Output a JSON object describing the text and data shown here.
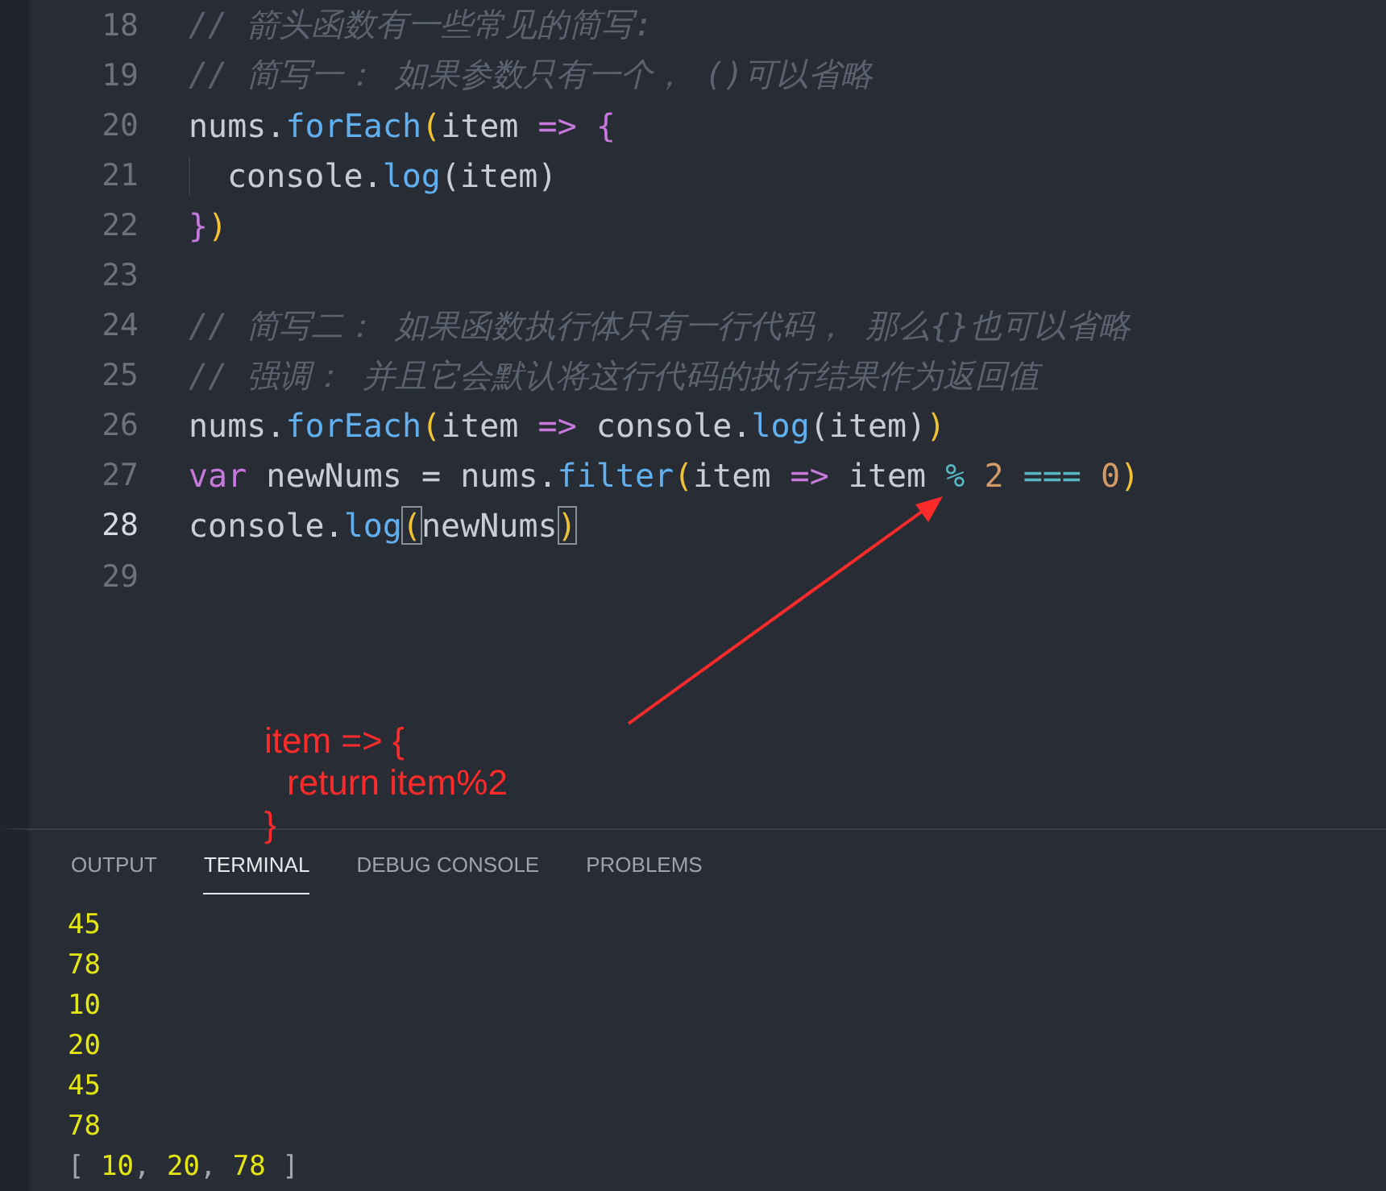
{
  "editor": {
    "lines": [
      {
        "number": "18",
        "active": false,
        "guide": false,
        "tokens": [
          {
            "kind": "comment",
            "text": "// 箭头函数有一些常见的简写:"
          }
        ]
      },
      {
        "number": "19",
        "active": false,
        "guide": false,
        "tokens": [
          {
            "kind": "comment",
            "text": "// 简写一： 如果参数只有一个， ()可以省略"
          }
        ]
      },
      {
        "number": "20",
        "active": false,
        "guide": false,
        "tokens": [
          {
            "kind": "plain",
            "text": "nums."
          },
          {
            "kind": "fn",
            "text": "forEach"
          },
          {
            "kind": "paren",
            "text": "("
          },
          {
            "kind": "plain",
            "text": "item "
          },
          {
            "kind": "keyword",
            "text": "=>"
          },
          {
            "kind": "brace",
            "text": " {"
          }
        ]
      },
      {
        "number": "21",
        "active": false,
        "guide": true,
        "tokens": [
          {
            "kind": "plain",
            "text": "console."
          },
          {
            "kind": "fn",
            "text": "log"
          },
          {
            "kind": "plain",
            "text": "(item)"
          }
        ]
      },
      {
        "number": "22",
        "active": false,
        "guide": false,
        "tokens": [
          {
            "kind": "brace",
            "text": "}"
          },
          {
            "kind": "paren",
            "text": ")"
          }
        ]
      },
      {
        "number": "23",
        "active": false,
        "guide": false
      },
      {
        "number": "24",
        "active": false,
        "guide": false,
        "tokens": [
          {
            "kind": "comment",
            "text": "// 简写二： 如果函数执行体只有一行代码， 那么{}也可以省略"
          }
        ]
      },
      {
        "number": "25",
        "active": false,
        "guide": false,
        "tokens": [
          {
            "kind": "comment",
            "text": "// 强调： 并且它会默认将这行代码的执行结果作为返回值"
          }
        ]
      },
      {
        "number": "26",
        "active": false,
        "guide": false,
        "tokens": [
          {
            "kind": "plain",
            "text": "nums."
          },
          {
            "kind": "fn",
            "text": "forEach"
          },
          {
            "kind": "paren",
            "text": "("
          },
          {
            "kind": "plain",
            "text": "item "
          },
          {
            "kind": "keyword",
            "text": "=>"
          },
          {
            "kind": "plain",
            "text": " console."
          },
          {
            "kind": "fn",
            "text": "log"
          },
          {
            "kind": "plain",
            "text": "(item)"
          },
          {
            "kind": "paren",
            "text": ")"
          }
        ]
      },
      {
        "number": "27",
        "active": false,
        "guide": false,
        "tokens": [
          {
            "kind": "keyword",
            "text": "var"
          },
          {
            "kind": "plain",
            "text": " newNums = nums."
          },
          {
            "kind": "fn",
            "text": "filter"
          },
          {
            "kind": "paren",
            "text": "("
          },
          {
            "kind": "plain",
            "text": "item "
          },
          {
            "kind": "keyword",
            "text": "=>"
          },
          {
            "kind": "plain",
            "text": " item "
          },
          {
            "kind": "operator",
            "text": "%"
          },
          {
            "kind": "number",
            "text": " 2"
          },
          {
            "kind": "operator",
            "text": " ==="
          },
          {
            "kind": "number",
            "text": " 0"
          },
          {
            "kind": "paren",
            "text": ")"
          }
        ]
      },
      {
        "number": "28",
        "active": true,
        "guide": false,
        "tokens": [
          {
            "kind": "plain",
            "text": "console."
          },
          {
            "kind": "fn",
            "text": "log"
          },
          {
            "kind": "matched",
            "text": "("
          },
          {
            "kind": "plain",
            "text": "newNums"
          },
          {
            "kind": "matched",
            "text": ")"
          }
        ]
      },
      {
        "number": "29",
        "active": false,
        "guide": false
      }
    ]
  },
  "panel": {
    "tabs": [
      {
        "label": "OUTPUT",
        "selected": false
      },
      {
        "label": "TERMINAL",
        "selected": true
      },
      {
        "label": "DEBUG CONSOLE",
        "selected": false
      },
      {
        "label": "PROBLEMS",
        "selected": false
      }
    ]
  },
  "terminal": {
    "lines": [
      [
        {
          "kind": "number",
          "text": "45"
        }
      ],
      [
        {
          "kind": "number",
          "text": "78"
        }
      ],
      [
        {
          "kind": "number",
          "text": "10"
        }
      ],
      [
        {
          "kind": "number",
          "text": "20"
        }
      ],
      [
        {
          "kind": "number",
          "text": "45"
        }
      ],
      [
        {
          "kind": "number",
          "text": "78"
        }
      ],
      [
        {
          "kind": "punct",
          "text": "[ "
        },
        {
          "kind": "number",
          "text": "10"
        },
        {
          "kind": "punct",
          "text": ", "
        },
        {
          "kind": "number",
          "text": "20"
        },
        {
          "kind": "punct",
          "text": ", "
        },
        {
          "kind": "number",
          "text": "78"
        },
        {
          "kind": "punct",
          "text": " ]"
        }
      ]
    ]
  },
  "annotation": {
    "lines": [
      "item => {",
      "return item%2",
      "}"
    ]
  }
}
